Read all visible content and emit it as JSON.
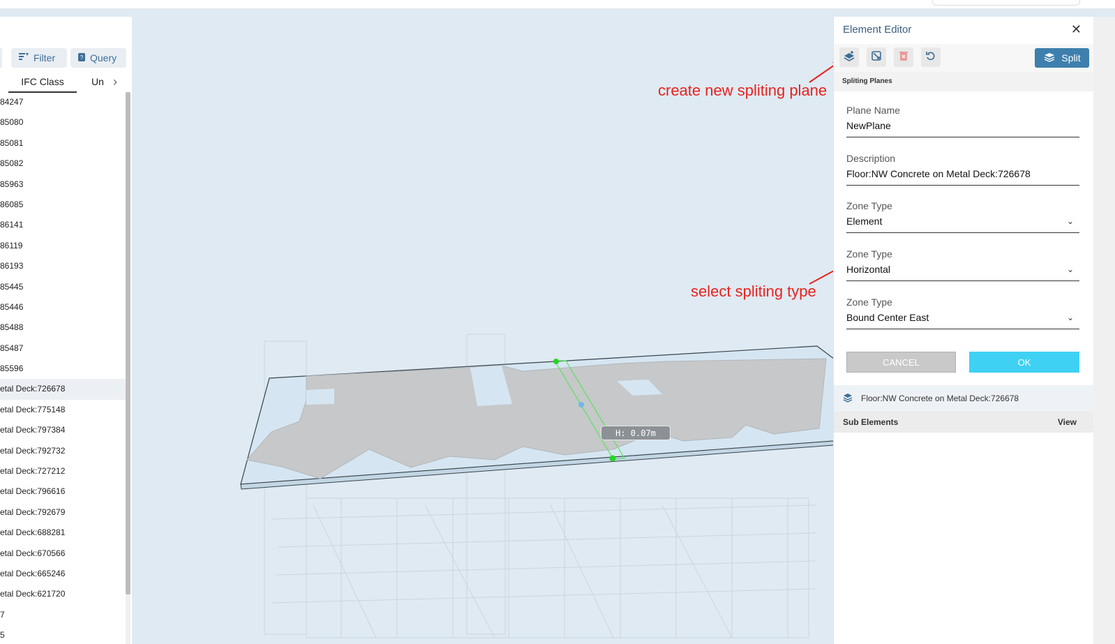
{
  "left_panel": {
    "filter_label": "Filter",
    "query_label": "Query",
    "tabs": [
      "IFC Class",
      "Un"
    ],
    "items": [
      "84247",
      "85080",
      "85081",
      "85082",
      "85963",
      "86085",
      "86141",
      "86119",
      "86193",
      "85445",
      "85446",
      "85488",
      "85487",
      "85596",
      "etal Deck:726678",
      "etal Deck:775148",
      "etal Deck:797384",
      "etal Deck:792732",
      "etal Deck:727212",
      "etal Deck:796616",
      "etal Deck:792679",
      "etal Deck:688281",
      "etal Deck:670566",
      "etal Deck:665246",
      "etal Deck:621720",
      "7",
      "5"
    ],
    "selected_index": 14
  },
  "viewport": {
    "measure_label": "H: 0.07m"
  },
  "annotations": {
    "create_plane": "create new spliting plane",
    "select_type": "select spliting type"
  },
  "editor": {
    "title": "Element Editor",
    "split_label": "Split",
    "section_title": "Spliting Planes",
    "fields": [
      {
        "label": "Plane Name",
        "value": "NewPlane"
      },
      {
        "label": "Description",
        "value": "Floor:NW Concrete on Metal Deck:726678"
      },
      {
        "label": "Zone Type",
        "value": "Element"
      },
      {
        "label": "Zone Type",
        "value": "Horizontal"
      },
      {
        "label": "Zone Type",
        "value": "Bound Center East"
      }
    ],
    "cancel_label": "CANCEL",
    "ok_label": "OK",
    "element_name": "Floor:NW Concrete on Metal Deck:726678",
    "sub_elements_label": "Sub Elements",
    "view_label": "View"
  },
  "colors": {
    "accent": "#3e7fae",
    "ok": "#3fd1f3",
    "annotation": "#e8231e",
    "handle": "#27d427"
  }
}
